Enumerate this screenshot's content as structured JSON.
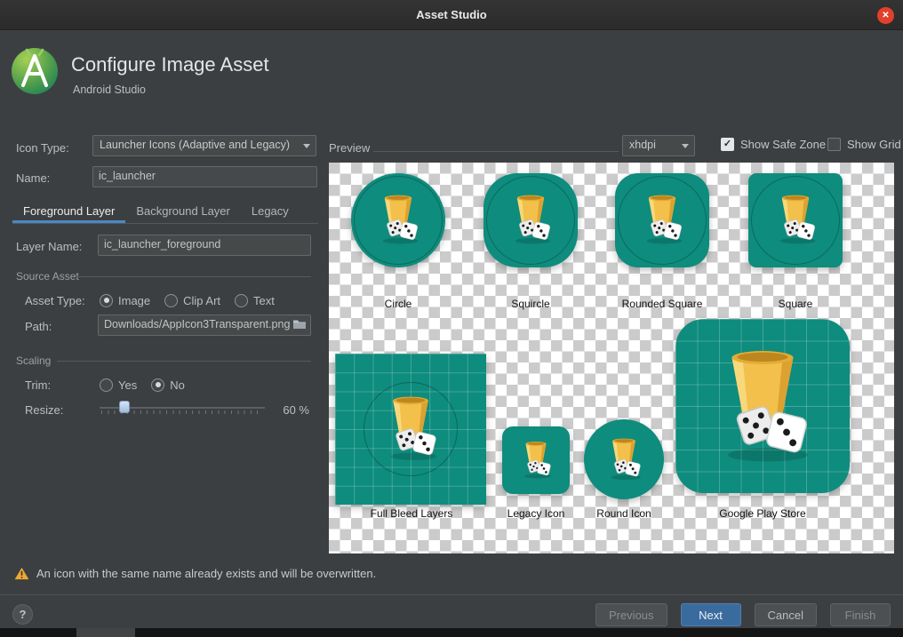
{
  "titlebar": {
    "title": "Asset Studio"
  },
  "header": {
    "title": "Configure Image Asset",
    "subtitle": "Android Studio"
  },
  "icons": {
    "close": "✕",
    "check": "✓",
    "help": "?"
  },
  "form": {
    "icon_type": {
      "label": "Icon Type:",
      "value": "Launcher Icons (Adaptive and Legacy)"
    },
    "name": {
      "label": "Name:",
      "value": "ic_launcher"
    },
    "tabs": [
      {
        "label": "Foreground Layer",
        "selected": true
      },
      {
        "label": "Background Layer",
        "selected": false
      },
      {
        "label": "Legacy",
        "selected": false
      }
    ],
    "layer_name": {
      "label": "Layer Name:",
      "value": "ic_launcher_foreground"
    },
    "source_asset_section": "Source Asset",
    "asset_type": {
      "label": "Asset Type:",
      "options": [
        {
          "label": "Image",
          "selected": true
        },
        {
          "label": "Clip Art",
          "selected": false
        },
        {
          "label": "Text",
          "selected": false
        }
      ]
    },
    "path": {
      "label": "Path:",
      "value": "Downloads/AppIcon3Transparent.png"
    },
    "scaling_section": "Scaling",
    "trim": {
      "label": "Trim:",
      "options": [
        {
          "label": "Yes",
          "selected": false
        },
        {
          "label": "No",
          "selected": true
        }
      ]
    },
    "resize": {
      "label": "Resize:",
      "value": "60 %",
      "percent": 60
    }
  },
  "preview": {
    "label": "Preview",
    "density": "xhdpi",
    "show_safe_zone": {
      "label": "Show Safe Zone",
      "checked": true
    },
    "show_grid": {
      "label": "Show Grid",
      "checked": false
    },
    "tiles": [
      {
        "label": "Circle"
      },
      {
        "label": "Squircle"
      },
      {
        "label": "Rounded Square"
      },
      {
        "label": "Square"
      },
      {
        "label": "Full Bleed Layers"
      },
      {
        "label": "Legacy Icon"
      },
      {
        "label": "Round Icon"
      },
      {
        "label": "Google Play Store"
      }
    ],
    "colors": {
      "icon_teal": "#0E8C7D",
      "cup_yellow": "#F2C04B",
      "accent_blue": "#4A88C7",
      "warning_yellow": "#F0A732"
    }
  },
  "warning": {
    "text": "An icon with the same name already exists and will be overwritten."
  },
  "footer": {
    "previous": "Previous",
    "next": "Next",
    "cancel": "Cancel",
    "finish": "Finish"
  }
}
